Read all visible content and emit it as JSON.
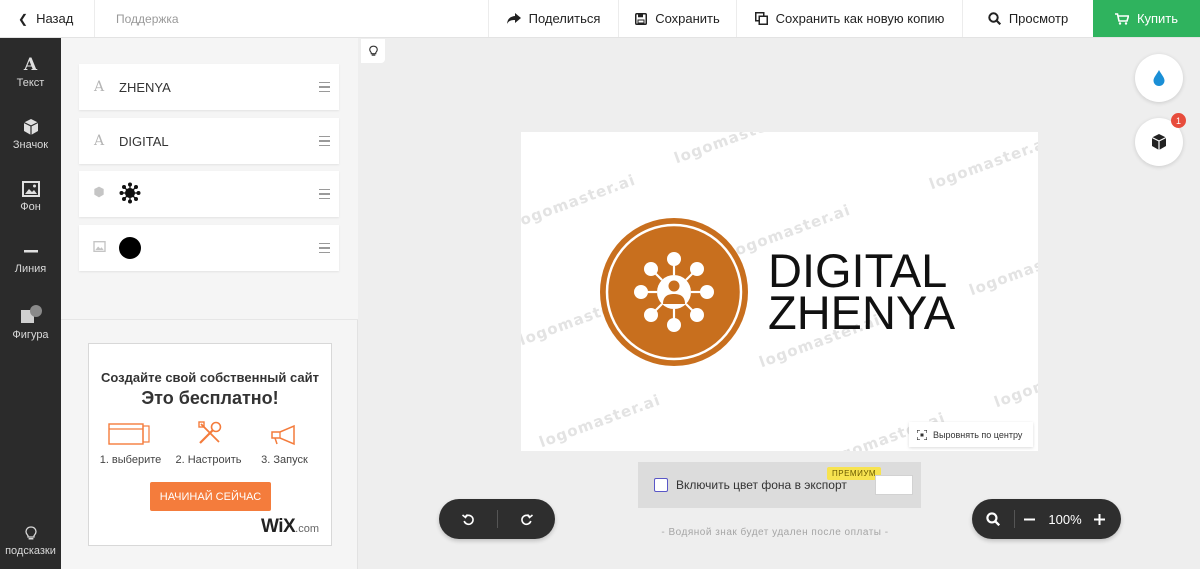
{
  "topbar": {
    "back_label": "Назад",
    "support_label": "Поддержка",
    "share_label": "Поделиться",
    "save_label": "Сохранить",
    "save_copy_label": "Сохранить как новую копию",
    "preview_label": "Просмотр",
    "buy_label": "Купить",
    "buy_color": "#2fb35e"
  },
  "sidebar": {
    "items": [
      {
        "label": "Текст",
        "icon": "text-icon"
      },
      {
        "label": "Значок",
        "icon": "cube-icon"
      },
      {
        "label": "Фон",
        "icon": "image-icon"
      },
      {
        "label": "Линия",
        "icon": "line-icon"
      },
      {
        "label": "Фигура",
        "icon": "shape-icon"
      }
    ],
    "hints_label": "подсказки"
  },
  "layers": [
    {
      "type": "text",
      "type_glyph": "A",
      "name": "ZHENYA"
    },
    {
      "type": "text",
      "type_glyph": "A",
      "name": "DIGITAL"
    },
    {
      "type": "icon",
      "name": ""
    },
    {
      "type": "background",
      "name": ""
    }
  ],
  "ad": {
    "title": "Создайте свой собственный сайт",
    "subtitle": "Это бесплатно!",
    "steps": [
      "1. выберите",
      "2. Настроить",
      "3. Запуск"
    ],
    "cta": "НАЧИНАЙ СЕЙЧАС",
    "brand": "WiX",
    "brand_suffix": ".com",
    "accent": "#f47c3c"
  },
  "canvas": {
    "logo_line1": "DIGITAL",
    "logo_line2": "ZHENYA",
    "watermark": "logomaster.ai",
    "logo_color": "#c86f1e",
    "align_center_label": "Выровнять по центру"
  },
  "export": {
    "include_bg_label": "Включить цвет фона в экспорт",
    "premium_label": "ПРЕМИУМ",
    "checked": false,
    "swatch_color": "#ffffff"
  },
  "watermark_note": "- Водяной знак будет удален после оплаты -",
  "zoom": {
    "value": "100%"
  },
  "right_tools": {
    "colors_icon": "droplet-icon",
    "icons_icon": "cube-icon",
    "badge_count": "1"
  }
}
